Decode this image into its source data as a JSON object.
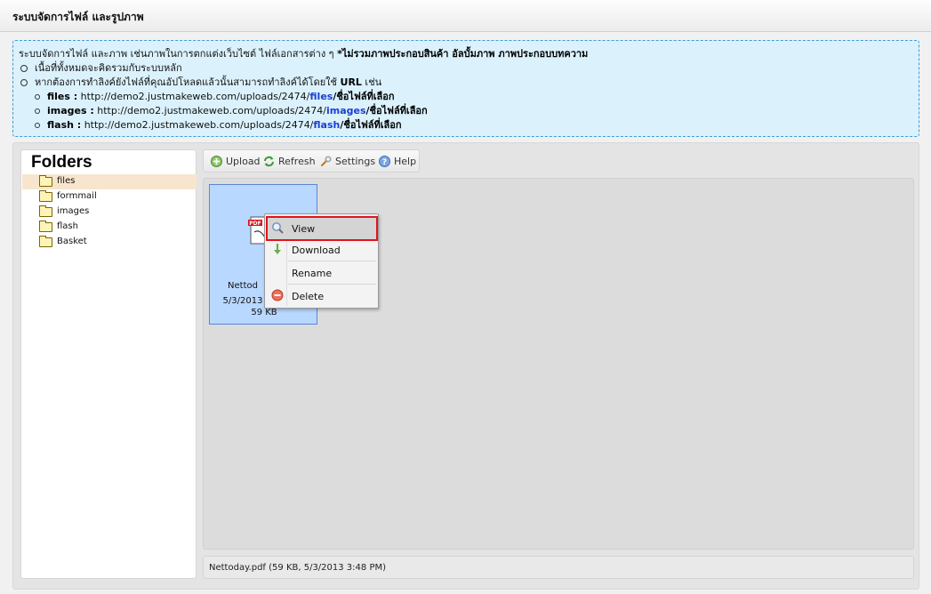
{
  "header": {
    "title": "ระบบจัดการไฟล์ และรูปภาพ"
  },
  "info": {
    "intro": "ระบบจัดการไฟล์ และภาพ เช่นภาพในการตกแต่งเว็บไซต์ ไฟล์เอกสารต่าง ๆ ",
    "intro_bold": "*ไม่รวมภาพประกอบสินค้า อัลบั้มภาพ ภาพประกอบบทความ",
    "note1": "เนื้อที่ทั้งหมดจะคิดรวมกับระบบหลัก",
    "note2_prefix": "หากต้องการทำลิงค์ยังไฟล์ที่คุณอัปโหลดแล้วนั้นสามารถทำลิงค์ได้โดยใช้ ",
    "note2_bold": "URL",
    "note2_suffix": " เช่น",
    "urls": [
      {
        "label": "files :",
        "prefix": "http://demo2.justmakeweb.com/uploads/2474/",
        "folder": "files",
        "suffix": "/ชื่อไฟล์ที่เลือก"
      },
      {
        "label": "images :",
        "prefix": "http://demo2.justmakeweb.com/uploads/2474/",
        "folder": "images",
        "suffix": "/ชื่อไฟล์ที่เลือก"
      },
      {
        "label": "flash :",
        "prefix": "http://demo2.justmakeweb.com/uploads/2474/",
        "folder": "flash",
        "suffix": "/ชื่อไฟล์ที่เลือก"
      }
    ]
  },
  "folders": {
    "title": "Folders",
    "items": [
      {
        "label": "files",
        "selected": true
      },
      {
        "label": "formmail",
        "selected": false
      },
      {
        "label": "images",
        "selected": false
      },
      {
        "label": "flash",
        "selected": false
      },
      {
        "label": "Basket",
        "selected": false
      }
    ]
  },
  "toolbar": {
    "upload": "Upload",
    "refresh": "Refresh",
    "settings": "Settings",
    "help": "Help"
  },
  "file": {
    "icon_text": "PDF",
    "name": "Nettod",
    "date": "5/3/2013",
    "size": "59 KB"
  },
  "context_menu": {
    "view": "View",
    "download": "Download",
    "rename": "Rename",
    "delete": "Delete"
  },
  "status": {
    "text": "Nettoday.pdf (59 KB, 5/3/2013 3:48 PM)"
  },
  "colors": {
    "accent_blue": "#1a3fcf",
    "selection_tile": "#b8d8ff",
    "highlight_border": "#e0131e",
    "folder_selected": "#f7e6cd",
    "info_bg": "#dbf2fd"
  }
}
